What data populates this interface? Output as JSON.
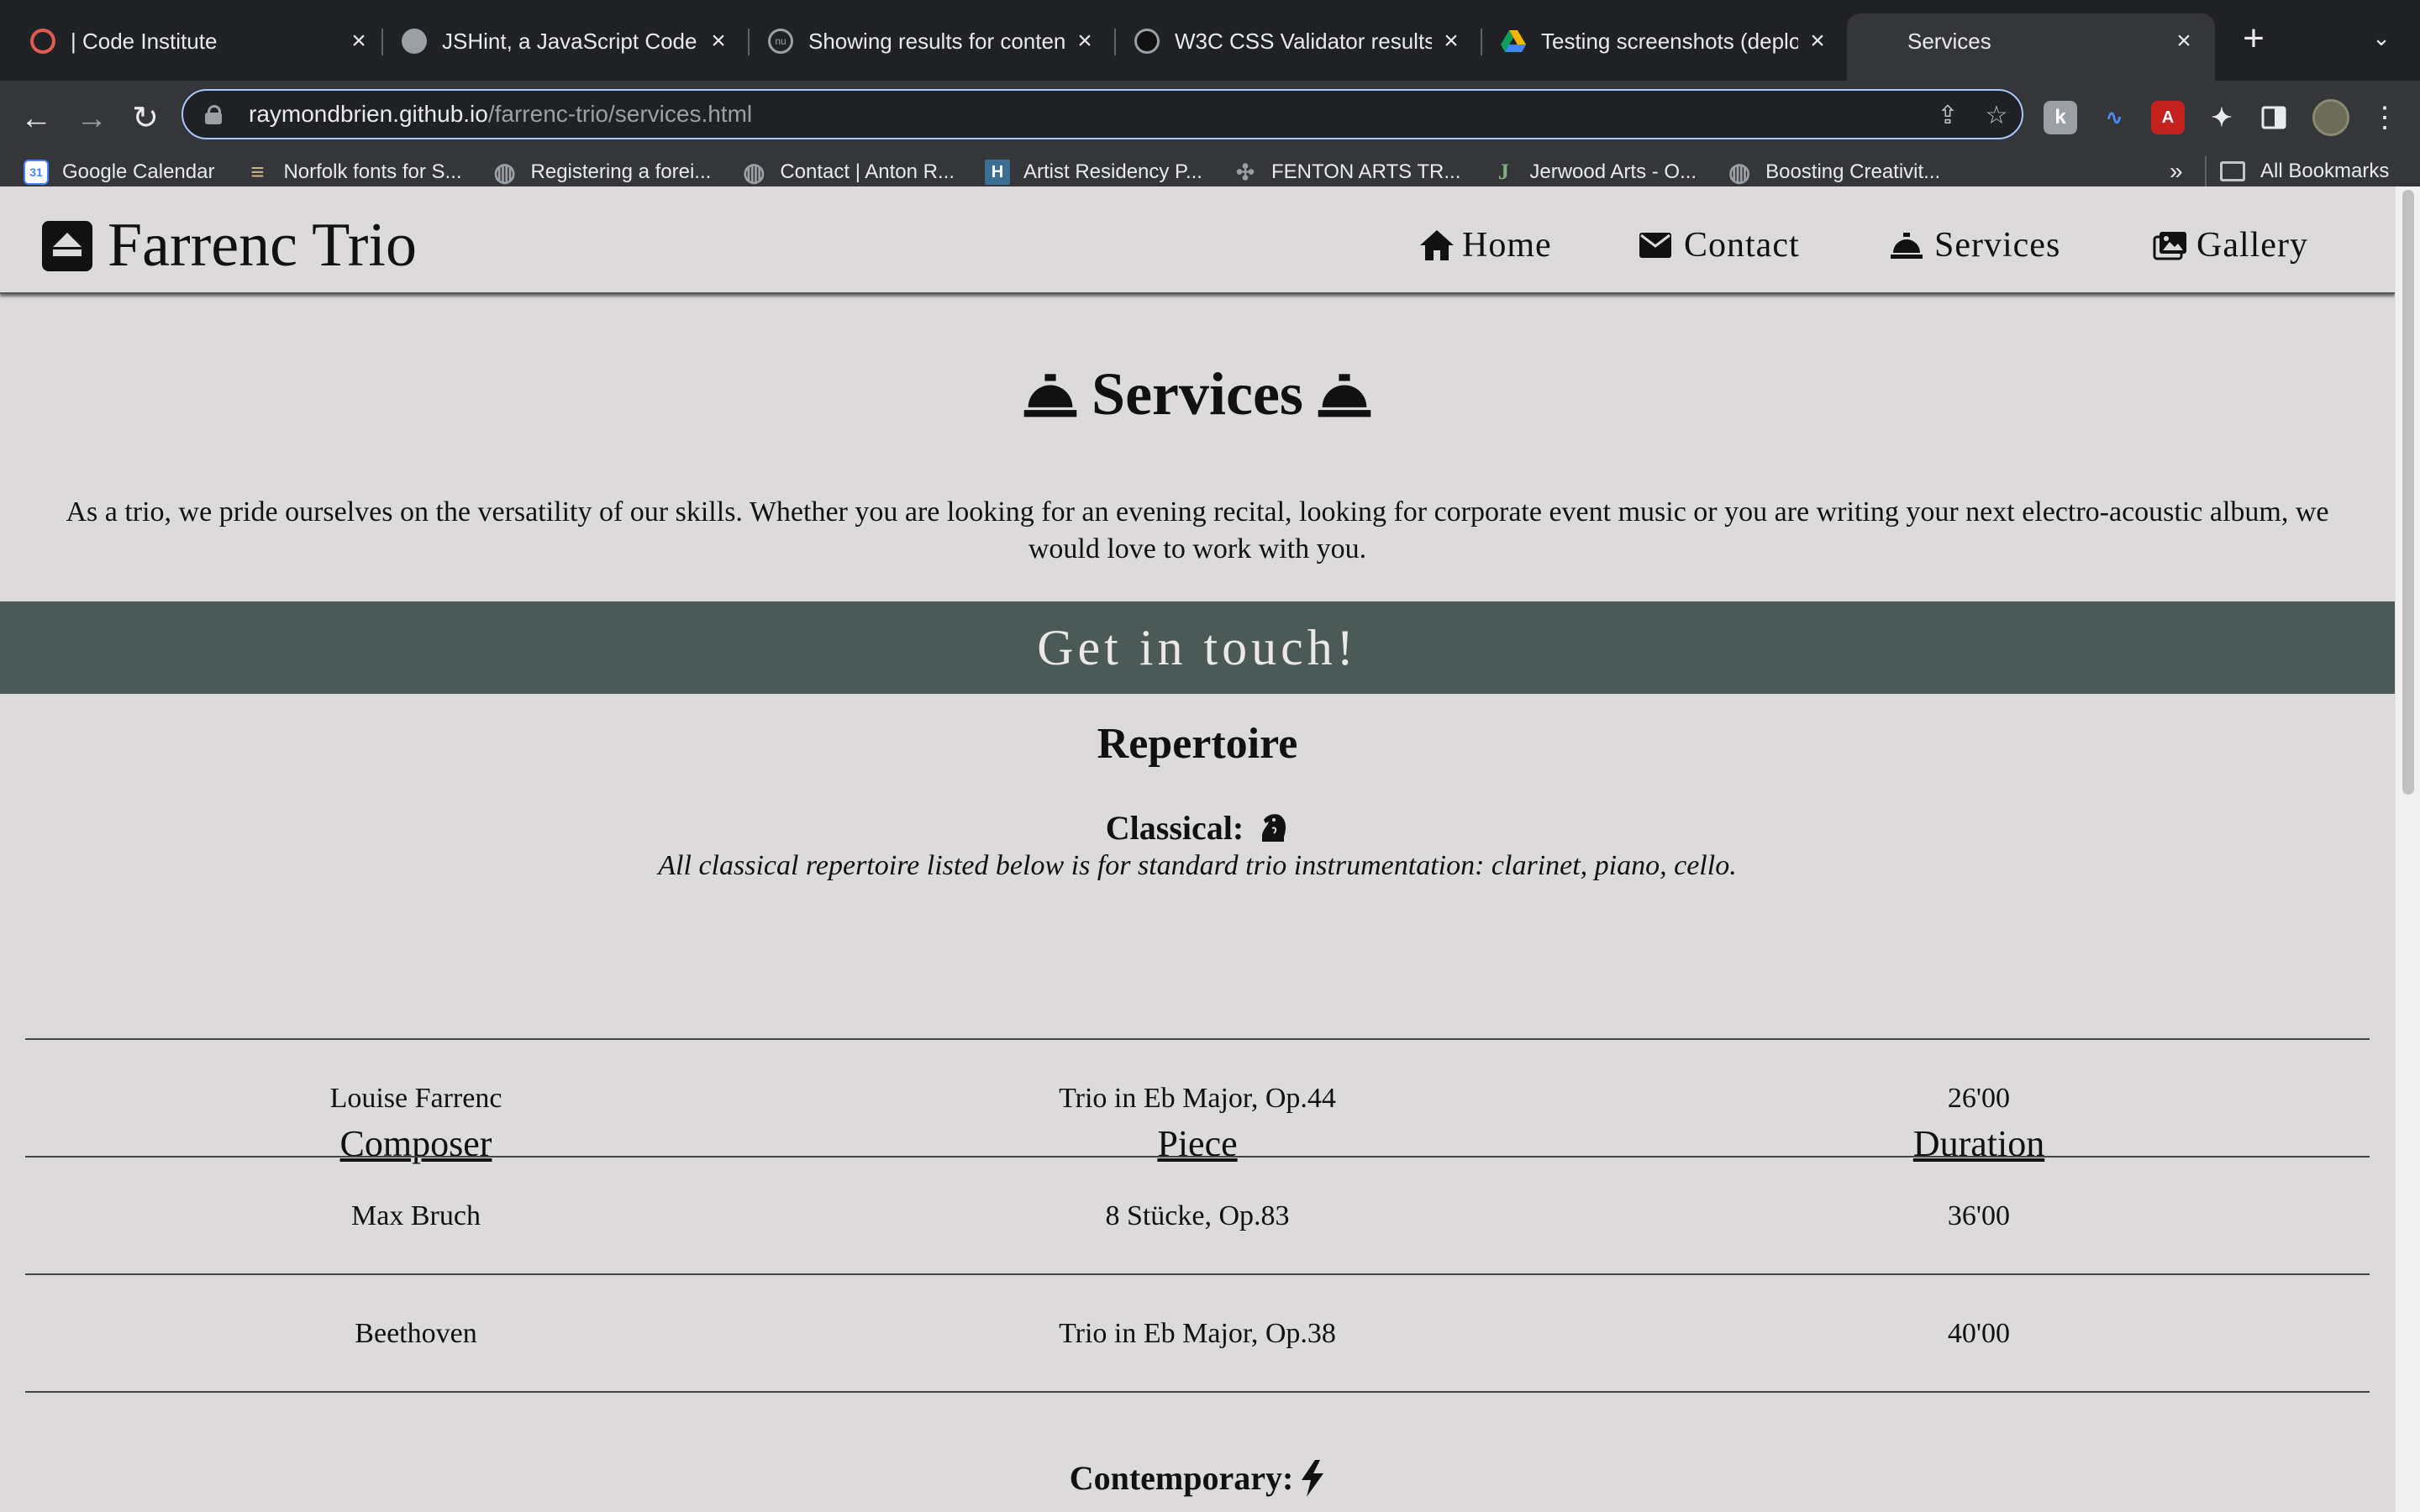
{
  "browser": {
    "tabs": [
      {
        "title": "| Code Institute",
        "favicon": "code-institute-icon",
        "fav_color": "#e15b4f"
      },
      {
        "title": "JSHint, a JavaScript Code",
        "favicon": "globe-icon",
        "fav_color": "#9aa0a6"
      },
      {
        "title": "Showing results for conten",
        "favicon": "w3c-nu-icon",
        "fav_color": "#5f6368"
      },
      {
        "title": "W3C CSS Validator results",
        "favicon": "w3c-icon",
        "fav_color": "#5f6368"
      },
      {
        "title": "Testing screenshots (deplo",
        "favicon": "google-drive-icon",
        "fav_color": "#f4b400"
      },
      {
        "title": "Services",
        "favicon": "none",
        "fav_color": "#35363a"
      }
    ],
    "url_host": "raymondbrien.github.io",
    "url_path": "/farrenc-trio/services.html",
    "bookmarks": [
      {
        "label": "Google Calendar",
        "icon": "calendar-icon",
        "color": "#4285f4",
        "glyph": "31"
      },
      {
        "label": "Norfolk fonts for S...",
        "icon": "fonts-icon",
        "color": "#c9b58a",
        "glyph": "≡"
      },
      {
        "label": "Registering a forei...",
        "icon": "globe-icon",
        "color": "#9aa0a6",
        "glyph": "◍"
      },
      {
        "label": "Contact | Anton R...",
        "icon": "globe-icon",
        "color": "#9aa0a6",
        "glyph": "◍"
      },
      {
        "label": "Artist Residency P...",
        "icon": "h-logo-icon",
        "color": "#3c6e91",
        "glyph": "H"
      },
      {
        "label": "FENTON ARTS TR...",
        "icon": "fenton-icon",
        "color": "#35363a",
        "glyph": "✣"
      },
      {
        "label": "Jerwood Arts - O...",
        "icon": "jerwood-icon",
        "color": "#35363a",
        "glyph": "J"
      },
      {
        "label": "Boosting Creativit...",
        "icon": "globe-icon",
        "color": "#9aa0a6",
        "glyph": "◍"
      }
    ],
    "bookmarks_more": "»",
    "all_bookmarks": "All Bookmarks"
  },
  "site": {
    "brand": "Farrenc Trio",
    "nav": {
      "home": "Home",
      "contact": "Contact",
      "services": "Services",
      "gallery": "Gallery"
    }
  },
  "services": {
    "title": "Services",
    "intro": "As a trio, we pride ourselves on the versatility of our skills. Whether you are looking for an evening recital, looking for corporate event music or you are writing your next electro-acoustic album, we would love to work with you.",
    "cta": "Get in touch!",
    "repertoire_title": "Repertoire",
    "classical_heading": "Classical:",
    "classical_note": "All classical repertoire listed below is for standard trio instrumentation: clarinet, piano, cello.",
    "table_headers": [
      "Composer",
      "Piece",
      "Duration"
    ],
    "classical_rows": [
      {
        "composer": "Louise Farrenc",
        "piece": "Trio in Eb Major, Op.44",
        "duration": "26'00"
      },
      {
        "composer": "Max Bruch",
        "piece": "8 Stücke, Op.83",
        "duration": "36'00"
      },
      {
        "composer": "Beethoven",
        "piece": "Trio in Eb Major, Op.38",
        "duration": "40'00"
      }
    ],
    "contemporary_heading": "Contemporary:"
  },
  "colors": {
    "page_bg": "#dcdadb",
    "cta_bg": "#4b5a57",
    "cta_text": "#e9e9e9",
    "chrome_dark": "#202124",
    "chrome_mid": "#35363a"
  }
}
